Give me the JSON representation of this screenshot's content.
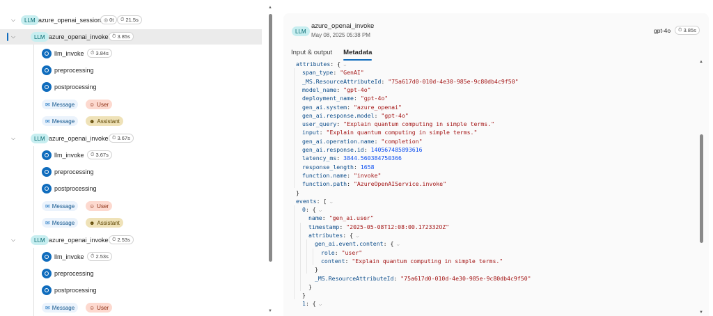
{
  "tree": {
    "session": {
      "badge": "LLM",
      "label": "azure_openai_session",
      "tokens": "0t",
      "latency": "21.5s"
    },
    "invokes": [
      {
        "badge": "LLM",
        "label": "azure_openai_invoke",
        "latency": "3.85s",
        "selected": true,
        "children": [
          {
            "label": "llm_invoke",
            "latency": "3.84s"
          },
          {
            "label": "preprocessing"
          },
          {
            "label": "postprocessing"
          }
        ],
        "messages": [
          {
            "label": "Message",
            "role": "User"
          },
          {
            "label": "Message",
            "role": "Assistant"
          }
        ]
      },
      {
        "badge": "LLM",
        "label": "azure_openai_invoke",
        "latency": "3.67s",
        "children": [
          {
            "label": "llm_invoke",
            "latency": "3.67s"
          },
          {
            "label": "preprocessing"
          },
          {
            "label": "postprocessing"
          }
        ],
        "messages": [
          {
            "label": "Message",
            "role": "User"
          },
          {
            "label": "Message",
            "role": "Assistant"
          }
        ]
      },
      {
        "badge": "LLM",
        "label": "azure_openai_invoke",
        "latency": "2.53s",
        "children": [
          {
            "label": "llm_invoke",
            "latency": "2.53s"
          },
          {
            "label": "preprocessing"
          },
          {
            "label": "postprocessing"
          }
        ],
        "messages": [
          {
            "label": "Message",
            "role": "User"
          }
        ]
      }
    ]
  },
  "detail": {
    "badge": "LLM",
    "title": "azure_openai_invoke",
    "date": "May 08, 2025 05:38 PM",
    "model": "gpt-4o",
    "latency": "3.85s",
    "tabs": [
      "Input & output",
      "Metadata"
    ],
    "active_tab": "Metadata",
    "code_lines": [
      {
        "indent": 0,
        "key": "attributes",
        "punct": ": {",
        "fold": true
      },
      {
        "indent": 1,
        "key": "span_type",
        "str": "\"GenAI\""
      },
      {
        "indent": 1,
        "key": "_MS.ResourceAttributeId",
        "str": "\"75a617d0-010d-4e30-985e-9c80db4c9f50\""
      },
      {
        "indent": 1,
        "key": "model_name",
        "str": "\"gpt-4o\""
      },
      {
        "indent": 1,
        "key": "deployment_name",
        "str": "\"gpt-4o\""
      },
      {
        "indent": 1,
        "key": "gen_ai.system",
        "str": "\"azure_openai\""
      },
      {
        "indent": 1,
        "key": "gen_ai.response.model",
        "str": "\"gpt-4o\""
      },
      {
        "indent": 1,
        "key": "user_query",
        "str": "\"Explain quantum computing in simple terms.\""
      },
      {
        "indent": 1,
        "key": "input",
        "str": "\"Explain quantum computing in simple terms.\""
      },
      {
        "indent": 1,
        "key": "gen_ai.operation.name",
        "str": "\"completion\""
      },
      {
        "indent": 1,
        "key": "gen_ai.response.id",
        "num": "140567485893616"
      },
      {
        "indent": 1,
        "key": "latency_ms",
        "num": "3844.560384750366"
      },
      {
        "indent": 1,
        "key": "response_length",
        "num": "1658"
      },
      {
        "indent": 1,
        "key": "function.name",
        "str": "\"invoke\""
      },
      {
        "indent": 1,
        "key": "function.path",
        "str": "\"AzureOpenAIService.invoke\""
      },
      {
        "indent": 0,
        "punct": "}"
      },
      {
        "indent": 0,
        "key": "events",
        "punct": ": [",
        "fold": true
      },
      {
        "indent": 1,
        "key": "0",
        "punct": ": {",
        "fold": true
      },
      {
        "indent": 2,
        "key": "name",
        "str": "\"gen_ai.user\""
      },
      {
        "indent": 2,
        "key": "timestamp",
        "str": "\"2025-05-08T12:08:00.172332OZ\""
      },
      {
        "indent": 2,
        "key": "attributes",
        "punct": ": {",
        "fold": true
      },
      {
        "indent": 3,
        "key": "gen_ai.event.content",
        "punct": ": {",
        "fold": true
      },
      {
        "indent": 4,
        "key": "role",
        "str": "\"user\""
      },
      {
        "indent": 4,
        "key": "content",
        "str": "\"Explain quantum computing in simple terms.\""
      },
      {
        "indent": 3,
        "punct": "}"
      },
      {
        "indent": 3,
        "key": "_MS.ResourceAttributeId",
        "str": "\"75a617d0-010d-4e30-985e-9c80db4c9f50\""
      },
      {
        "indent": 2,
        "punct": "}"
      },
      {
        "indent": 1,
        "punct": "}"
      },
      {
        "indent": 1,
        "key": "1",
        "punct": ": {",
        "fold": true
      }
    ]
  },
  "icons": {
    "chevron_down": "chevron-down-icon",
    "clock": "clock-icon",
    "token": "token-icon",
    "message": "mail-icon",
    "user": "person-icon",
    "assistant": "bot-icon",
    "circle_node": "node-circle-icon"
  },
  "colors": {
    "accent": "#0f6cbd",
    "llm_badge_bg": "#c7eef0",
    "llm_badge_fg": "#00666d",
    "user_chip_bg": "#fdd9cf",
    "assistant_chip_bg": "#efe2b8",
    "json_key": "#0b4c8a",
    "json_string": "#a31515",
    "json_number": "#0b4ef0"
  }
}
